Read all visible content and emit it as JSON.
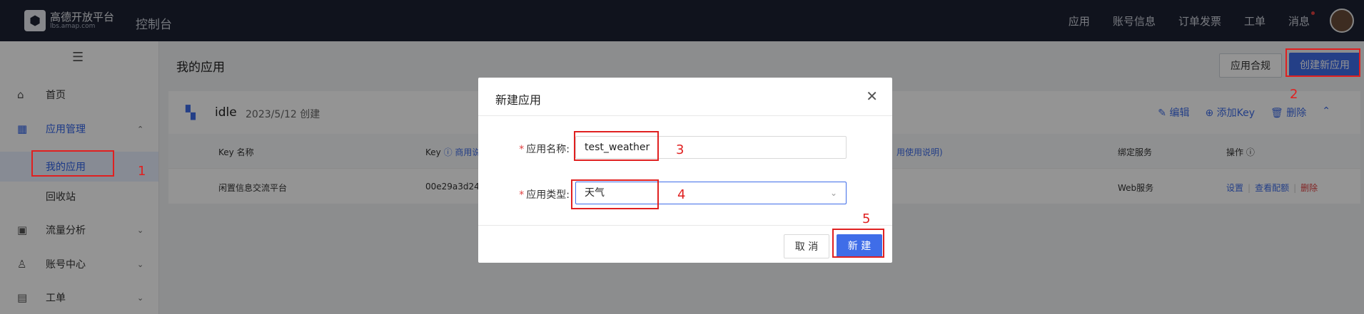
{
  "topbar": {
    "logo_title": "高德开放平台",
    "logo_sub": "lbs.amap.com",
    "console_title": "控制台",
    "nav": [
      "应用",
      "账号信息",
      "订单发票",
      "工单",
      "消息"
    ]
  },
  "sidebar": {
    "home": "首页",
    "app_manage": "应用管理",
    "my_apps": "我的应用",
    "recycle_bin": "回收站",
    "traffic_analysis": "流量分析",
    "account_center": "账号中心",
    "work_order": "工单"
  },
  "main": {
    "title": "我的应用",
    "compliance_button": "应用合规",
    "create_button": "创建新应用"
  },
  "app_card": {
    "name": "idle",
    "created": "2023/5/12 创建",
    "actions": [
      "编辑",
      "添加Key",
      "删除"
    ],
    "headers": {
      "key_name": "Key 名称",
      "key": "Key",
      "key_note": "商用说",
      "usage_note": "用使用说明)",
      "service": "绑定服务",
      "ops": "操作"
    },
    "row": {
      "key_name": "闲置信息交流平台",
      "key": "00e29a3d24",
      "service": "Web服务",
      "op_settings": "设置",
      "op_quota": "查看配额",
      "op_delete": "删除"
    }
  },
  "modal": {
    "title": "新建应用",
    "name_label": "应用名称:",
    "name_value": "test_weather",
    "type_label": "应用类型:",
    "type_value": "天气",
    "cancel": "取 消",
    "ok": "新 建"
  },
  "annotations": [
    "1",
    "2",
    "3",
    "4",
    "5"
  ],
  "colors": {
    "accent": "#3f6de8",
    "annotation": "#e02020",
    "topbar": "#1c2233"
  }
}
